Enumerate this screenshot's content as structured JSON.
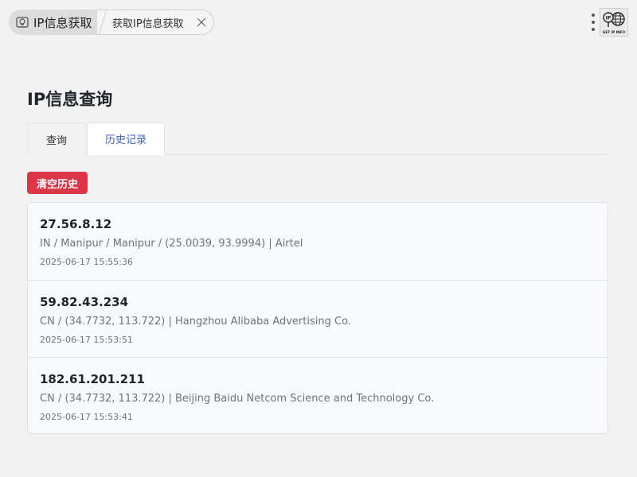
{
  "window": {
    "main_tab_label": "IP信息获取",
    "sub_tab_label": "获取IP信息获取",
    "logo_top_text": "IP",
    "logo_bottom_text": "GET IP INFO"
  },
  "page": {
    "title": "IP信息查询"
  },
  "tabs": [
    {
      "label": "查询",
      "active": false
    },
    {
      "label": "历史记录",
      "active": true
    }
  ],
  "actions": {
    "clear_history_label": "清空历史"
  },
  "colors": {
    "danger": "#dc3545",
    "active_tab_text": "#3d67b8"
  },
  "history": [
    {
      "ip": "27.56.8.12",
      "info": "IN / Manipur / Manipur / (25.0039, 93.9994) | Airtel",
      "time": "2025-06-17 15:55:36"
    },
    {
      "ip": "59.82.43.234",
      "info": "CN / (34.7732, 113.722) | Hangzhou Alibaba Advertising Co.",
      "time": "2025-06-17 15:53:51"
    },
    {
      "ip": "182.61.201.211",
      "info": "CN / (34.7732, 113.722) | Beijing Baidu Netcom Science and Technology Co.",
      "time": "2025-06-17 15:53:41"
    }
  ]
}
